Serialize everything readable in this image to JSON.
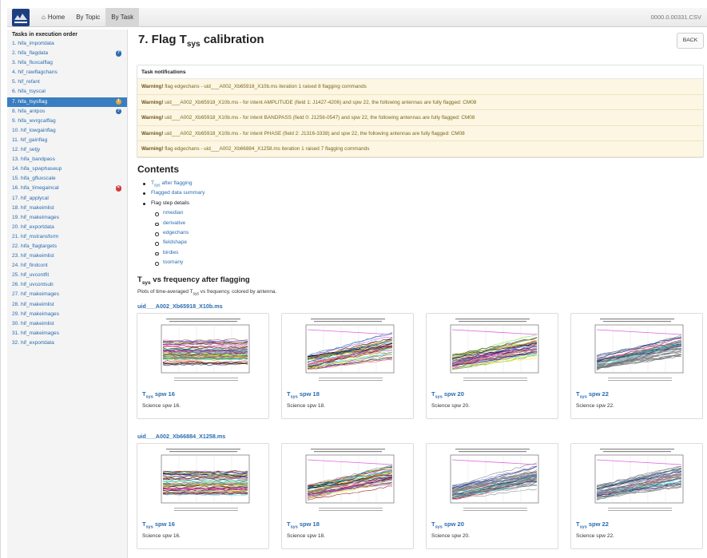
{
  "navbar": {
    "home": "Home",
    "by_topic": "By Topic",
    "by_task": "By Task",
    "right_text": "0000.0.00331.CSV"
  },
  "sidebar": {
    "heading": "Tasks in execution order",
    "items": [
      {
        "label": "1. hifa_importdata",
        "badge": ""
      },
      {
        "label": "2. hifa_flagdata",
        "badge": "info"
      },
      {
        "label": "3. hifa_fluxcalflag",
        "badge": ""
      },
      {
        "label": "4. hif_rawflagchans",
        "badge": ""
      },
      {
        "label": "5. hif_refant",
        "badge": ""
      },
      {
        "label": "6. hifa_tsyscal",
        "badge": ""
      },
      {
        "label": "7. hifa_tsysflag",
        "badge": "warn",
        "active": true
      },
      {
        "label": "8. hifa_antpos",
        "badge": "info"
      },
      {
        "label": "9. hifa_wvrgcalflag",
        "badge": ""
      },
      {
        "label": "10. hif_lowgainflag",
        "badge": ""
      },
      {
        "label": "11. hif_gainflag",
        "badge": ""
      },
      {
        "label": "12. hif_setjy",
        "badge": ""
      },
      {
        "label": "13. hifa_bandpass",
        "badge": ""
      },
      {
        "label": "14. hifa_spwphaseup",
        "badge": ""
      },
      {
        "label": "15. hifa_gfluxscale",
        "badge": ""
      },
      {
        "label": "16. hifa_timegaincal",
        "badge": "error"
      },
      {
        "label": "17. hif_applycal",
        "badge": ""
      },
      {
        "label": "18. hif_makeimlist",
        "badge": ""
      },
      {
        "label": "19. hif_makeimages",
        "badge": ""
      },
      {
        "label": "20. hif_exportdata",
        "badge": ""
      },
      {
        "label": "21. hif_mstransform",
        "badge": ""
      },
      {
        "label": "22. hifa_flagtargets",
        "badge": ""
      },
      {
        "label": "23. hif_makeimlist",
        "badge": ""
      },
      {
        "label": "24. hif_findcont",
        "badge": ""
      },
      {
        "label": "25. hif_uvcontfit",
        "badge": ""
      },
      {
        "label": "26. hif_uvcontsub",
        "badge": ""
      },
      {
        "label": "27. hif_makeimages",
        "badge": ""
      },
      {
        "label": "28. hif_makeimlist",
        "badge": ""
      },
      {
        "label": "29. hif_makeimages",
        "badge": ""
      },
      {
        "label": "30. hif_makeimlist",
        "badge": ""
      },
      {
        "label": "31. hif_makeimages",
        "badge": ""
      },
      {
        "label": "32. hif_exportdata",
        "badge": ""
      }
    ]
  },
  "page": {
    "title_pre": "7. Flag T",
    "title_sub": "sys",
    "title_post": " calibration",
    "back": "BACK"
  },
  "notifications": {
    "heading": "Task notifications",
    "rows": [
      {
        "strong": "Warning!",
        "text": " flag edgechans - uid___A002_Xb65918_X10b.ms iteration 1 raised 8 flagging commands"
      },
      {
        "strong": "Warning!",
        "text": " uid___A002_Xb65918_X10b.ms - for intent AMPLITUDE (field 1: J1427-4206) and spw 22, the following antennas are fully flagged: CM08"
      },
      {
        "strong": "Warning!",
        "text": " uid___A002_Xb65918_X10b.ms - for intent BANDPASS (field 0: J1256-0547) and spw 22, the following antennas are fully flagged: CM08"
      },
      {
        "strong": "Warning!",
        "text": " uid___A002_Xb65918_X10b.ms - for intent PHASE (field 2: J1316-3338) and spw 22, the following antennas are fully flagged: CM08"
      },
      {
        "strong": "Warning!",
        "text": " flag edgechans - uid___A002_Xb66884_X1258.ms iteration 1 raised 7 flagging commands"
      }
    ]
  },
  "contents": {
    "heading": "Contents",
    "tsys_pre": "T",
    "tsys_sub": "sys",
    "tsys_post": " after flagging",
    "flagged_summary": "Flagged data summary",
    "flag_step": "Flag step details",
    "sub_items": [
      "nmedian",
      "derivative",
      "edgechans",
      "fieldshape",
      "birdies",
      "toomany"
    ]
  },
  "section": {
    "h_pre": "T",
    "h_sub": "sys",
    "h_post": " vs frequency after flagging",
    "desc_pre": "Plots of time-averaged T",
    "desc_sub": "sys",
    "desc_post": " vs frequency, colored by antenna."
  },
  "ms_groups": [
    {
      "name": "uid___A002_Xb65918_X10b.ms",
      "cards": [
        {
          "t_pre": "T",
          "t_sub": "sys",
          "t_post": " spw 16",
          "caption": "Science spw 16."
        },
        {
          "t_pre": "T",
          "t_sub": "sys",
          "t_post": " spw 18",
          "caption": "Science spw 18."
        },
        {
          "t_pre": "T",
          "t_sub": "sys",
          "t_post": " spw 20",
          "caption": "Science spw 20."
        },
        {
          "t_pre": "T",
          "t_sub": "sys",
          "t_post": " spw 22",
          "caption": "Science spw 22."
        }
      ]
    },
    {
      "name": "uid___A002_Xb66884_X1258.ms",
      "cards": [
        {
          "t_pre": "T",
          "t_sub": "sys",
          "t_post": " spw 16",
          "caption": "Science spw 16."
        },
        {
          "t_pre": "T",
          "t_sub": "sys",
          "t_post": " spw 18",
          "caption": "Science spw 18."
        },
        {
          "t_pre": "T",
          "t_sub": "sys",
          "t_post": " spw 20",
          "caption": "Science spw 20."
        },
        {
          "t_pre": "T",
          "t_sub": "sys",
          "t_post": " spw 22",
          "caption": "Science spw 22."
        }
      ]
    }
  ],
  "colors": {
    "link": "#2b6cb0",
    "active_sidebar": "#3a7ec2",
    "warning_bg": "#fcf6e2",
    "warning_text": "#7d6620"
  }
}
